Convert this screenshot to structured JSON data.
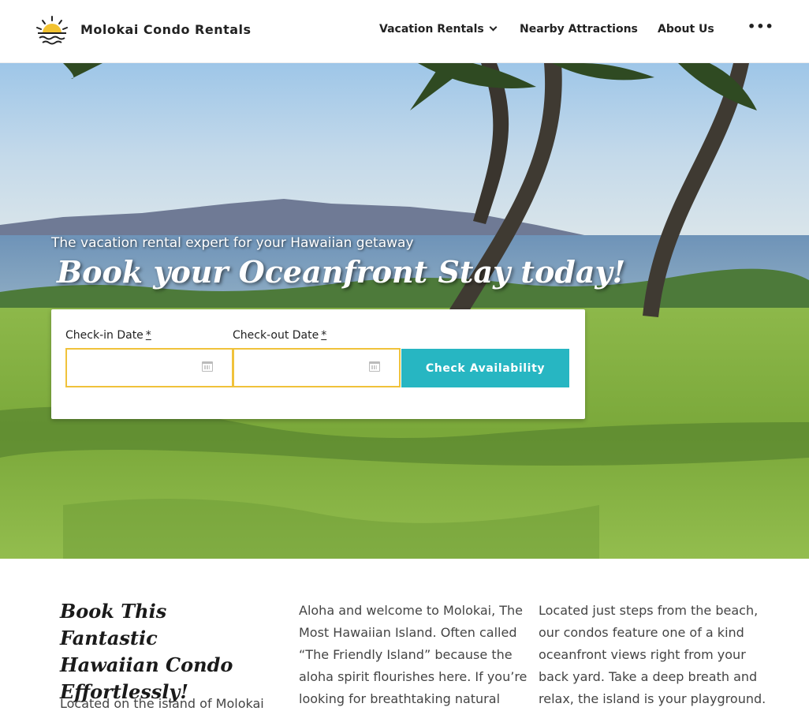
{
  "header": {
    "brand": "Molokai Condo Rentals",
    "logo_icon": "sunset-logo-icon",
    "nav": [
      {
        "label": "Vacation Rentals"
      },
      {
        "label": "Nearby Attractions"
      },
      {
        "label": "About Us"
      },
      {
        "label": "•••"
      }
    ]
  },
  "hero": {
    "tagline": "The vacation rental expert for your Hawaiian getaway",
    "headline": "Book your Oceanfront Stay today!",
    "booking": {
      "checkin_label": "Check-in Date",
      "checkout_label": "Check-out Date",
      "required_mark": "*",
      "checkin_value": "",
      "checkout_value": "",
      "button": "Check Availability",
      "accent_color": "#27b6c2",
      "field_border_color": "#f0c23b"
    }
  },
  "content": {
    "title": "Book This Fantastic Hawaiian Condo Effortlessly!",
    "intro": "Located on the island of Molokai",
    "col2": "Aloha and welcome to Molokai, The Most Hawaiian Island. Often called “The Friendly Island” because the aloha spirit flourishes here. If you’re looking for breathtaking natural",
    "col3": "Located just steps from the beach, our condos feature one of a kind oceanfront views right from your back yard. Take a deep breath and relax, the island is your playground."
  }
}
